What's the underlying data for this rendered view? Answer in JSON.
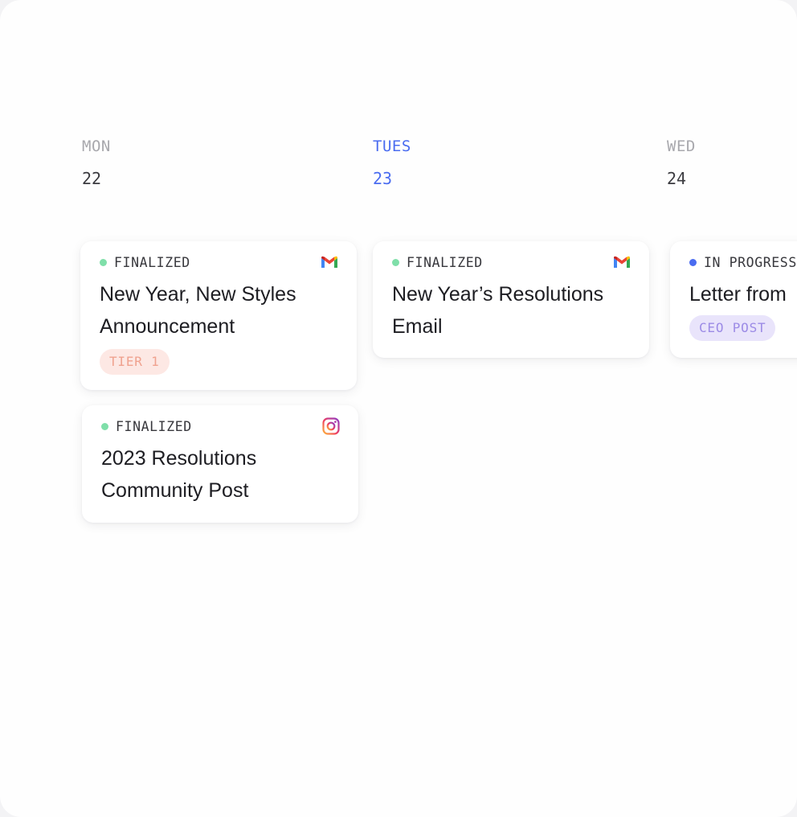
{
  "colors": {
    "accent": "#4a6cf0",
    "finalized_dot": "#7fdfa9",
    "in_progress_dot": "#4a6cf0",
    "tier_tag_bg": "#fde8e4",
    "tier_tag_text": "#f0a28f",
    "ceo_tag_bg": "#e9e4fb",
    "ceo_tag_text": "#9c8be6"
  },
  "days": [
    {
      "name": "MON",
      "date": "22"
    },
    {
      "name": "TUES",
      "date": "23"
    },
    {
      "name": "WED",
      "date": "24"
    }
  ],
  "cards": [
    {
      "status": "FINALIZED",
      "channel_icon": "gmail-icon",
      "title_line1": "New Year, New Styles",
      "title_line2": "Announcement",
      "tag": "TIER 1"
    },
    {
      "status": "FINALIZED",
      "channel_icon": "instagram-icon",
      "title_line1": "2023 Resolutions",
      "title_line2": "Community Post"
    },
    {
      "status": "FINALIZED",
      "channel_icon": "gmail-icon",
      "title_line1": "New Year’s Resolutions",
      "title_line2": "Email"
    },
    {
      "status": "IN PROGRESS",
      "title_line1": "Letter from",
      "tag": "CEO POST"
    }
  ]
}
